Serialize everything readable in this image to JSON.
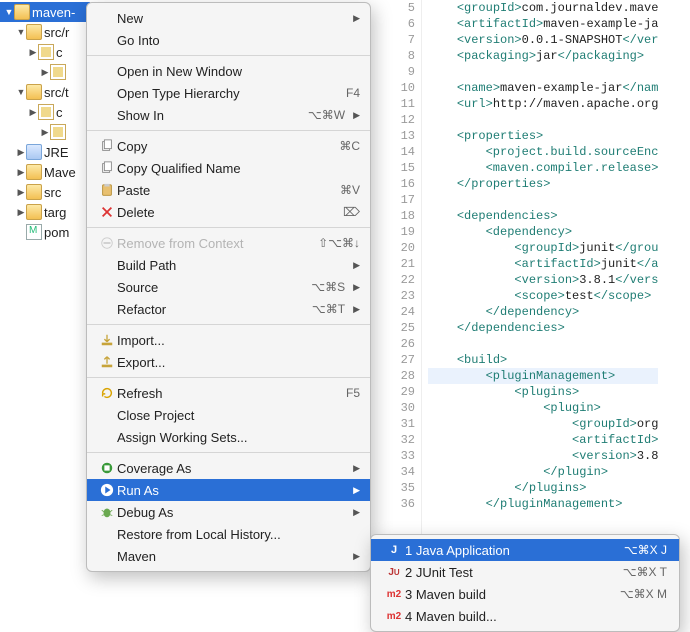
{
  "tree": {
    "items": [
      {
        "label": "maven-",
        "sel": true,
        "disc": "▼"
      },
      {
        "label": "src/r",
        "disc": "▼",
        "indent": 1
      },
      {
        "label": "c",
        "disc": "▶",
        "indent": 2
      },
      {
        "label": "",
        "disc": "▶",
        "indent": 3
      },
      {
        "label": "src/t",
        "disc": "▼",
        "indent": 1
      },
      {
        "label": "c",
        "disc": "▶",
        "indent": 2
      },
      {
        "label": "",
        "disc": "▶",
        "indent": 3
      },
      {
        "label": "JRE",
        "disc": "▶",
        "indent": 1
      },
      {
        "label": "Mave",
        "disc": "▶",
        "indent": 1
      },
      {
        "label": "src",
        "disc": "▶",
        "indent": 1
      },
      {
        "label": "targ",
        "disc": "▶",
        "indent": 1
      },
      {
        "label": "pom",
        "disc": "",
        "indent": 1
      }
    ]
  },
  "menu": {
    "items": [
      {
        "label": "New",
        "submenu": true
      },
      {
        "label": "Go Into"
      },
      {
        "sep": true
      },
      {
        "label": "Open in New Window"
      },
      {
        "label": "Open Type Hierarchy",
        "shortcut": "F4"
      },
      {
        "label": "Show In",
        "shortcut": "⌥⌘W",
        "submenu": true
      },
      {
        "sep": true
      },
      {
        "label": "Copy",
        "icon": "copy",
        "shortcut": "⌘C"
      },
      {
        "label": "Copy Qualified Name",
        "icon": "copy"
      },
      {
        "label": "Paste",
        "icon": "paste",
        "shortcut": "⌘V"
      },
      {
        "label": "Delete",
        "icon": "delete",
        "shortcut": "⌦"
      },
      {
        "sep": true
      },
      {
        "label": "Remove from Context",
        "icon": "remove",
        "shortcut": "⇧⌥⌘↓",
        "disabled": true
      },
      {
        "label": "Build Path",
        "submenu": true
      },
      {
        "label": "Source",
        "shortcut": "⌥⌘S",
        "submenu": true
      },
      {
        "label": "Refactor",
        "shortcut": "⌥⌘T",
        "submenu": true
      },
      {
        "sep": true
      },
      {
        "label": "Import...",
        "icon": "import"
      },
      {
        "label": "Export...",
        "icon": "export"
      },
      {
        "sep": true
      },
      {
        "label": "Refresh",
        "icon": "refresh",
        "shortcut": "F5"
      },
      {
        "label": "Close Project"
      },
      {
        "label": "Assign Working Sets..."
      },
      {
        "sep": true
      },
      {
        "label": "Coverage As",
        "icon": "coverage",
        "submenu": true
      },
      {
        "label": "Run As",
        "icon": "run",
        "submenu": true,
        "highlight": true
      },
      {
        "label": "Debug As",
        "icon": "debug",
        "submenu": true
      },
      {
        "label": "Restore from Local History..."
      },
      {
        "label": "Maven",
        "submenu": true
      }
    ]
  },
  "submenu": {
    "items": [
      {
        "icon": "java",
        "label": "1 Java Application",
        "shortcut": "⌥⌘X J",
        "highlight": true
      },
      {
        "icon": "junit",
        "label": "2 JUnit Test",
        "shortcut": "⌥⌘X T"
      },
      {
        "icon": "m2",
        "label": "3 Maven build",
        "shortcut": "⌥⌘X M"
      },
      {
        "icon": "m2",
        "label": "4 Maven build..."
      }
    ]
  },
  "editor": {
    "startLine": 5,
    "lines": [
      "    <groupId>com.journaldev.mave",
      "    <artifactId>maven-example-ja",
      "    <version>0.0.1-SNAPSHOT</ver",
      "    <packaging>jar</packaging>",
      "",
      "    <name>maven-example-jar</nam",
      "    <url>http://maven.apache.org",
      "",
      "    <properties>",
      "        <project.build.sourceEnc",
      "        <maven.compiler.release>",
      "    </properties>",
      "",
      "    <dependencies>",
      "        <dependency>",
      "            <groupId>junit</grou",
      "            <artifactId>junit</a",
      "            <version>3.8.1</vers",
      "            <scope>test</scope>",
      "        </dependency>",
      "    </dependencies>",
      "",
      "    <build>",
      "        <pluginManagement>",
      "            <plugins>",
      "                <plugin>",
      "                    <groupId>org",
      "                    <artifactId>",
      "                    <version>3.8",
      "                </plugin>",
      "            </plugins>",
      "        </pluginManagement>"
    ],
    "highlightLine": 28
  }
}
